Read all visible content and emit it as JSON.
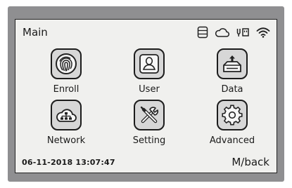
{
  "screen": {
    "title": "Main"
  },
  "status_icons": [
    "storage-icon",
    "cloud-icon",
    "usb-icon",
    "wifi-icon"
  ],
  "menu": [
    {
      "label": "Enroll",
      "icon": "fingerprint-icon"
    },
    {
      "label": "User",
      "icon": "user-icon"
    },
    {
      "label": "Data",
      "icon": "data-transfer-icon"
    },
    {
      "label": "Network",
      "icon": "network-cloud-icon"
    },
    {
      "label": "Setting",
      "icon": "tools-icon"
    },
    {
      "label": "Advanced",
      "icon": "gear-icon"
    }
  ],
  "footer": {
    "datetime": "06-11-2018  13:07:47",
    "back_label": "M/back"
  },
  "colors": {
    "icon_box": "#d7d7d7",
    "screen_bg": "#f0f0ee",
    "bezel": "#8f8f91"
  }
}
